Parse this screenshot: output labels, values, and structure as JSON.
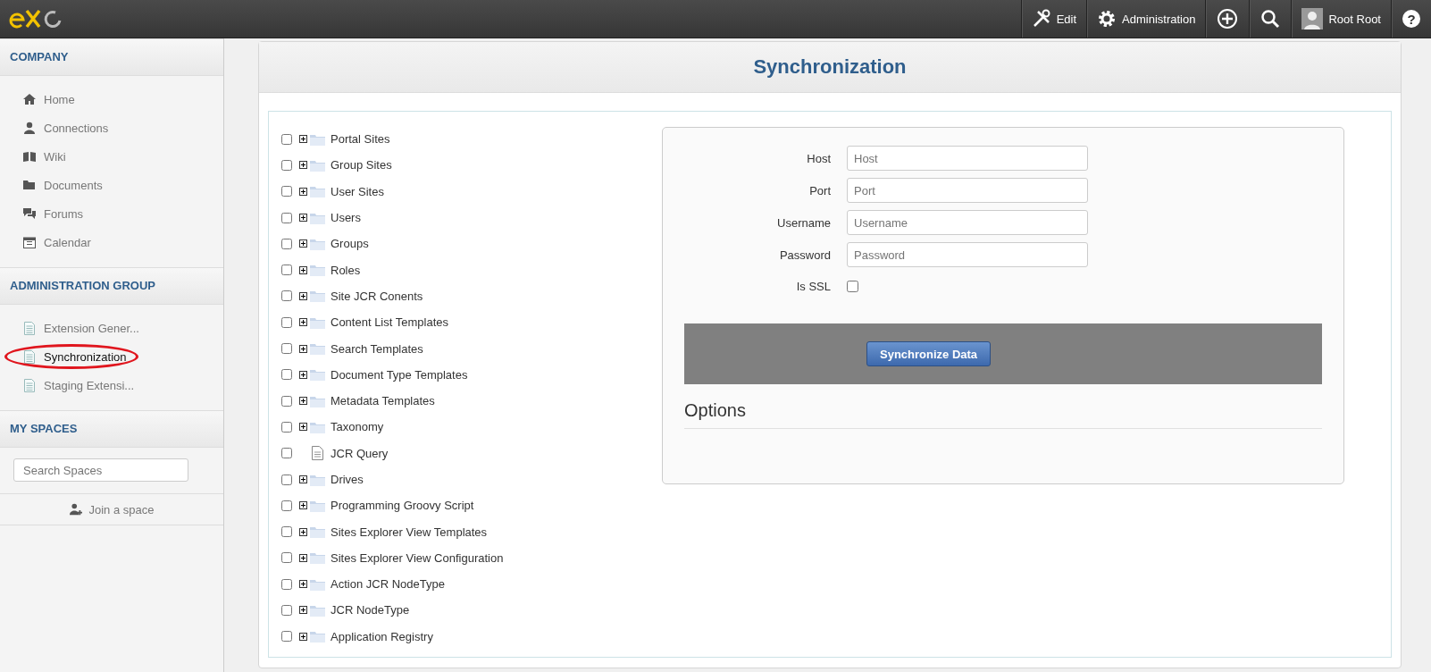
{
  "topbar": {
    "items": [
      {
        "kind": "edit",
        "label": "Edit"
      },
      {
        "kind": "admin",
        "label": "Administration"
      },
      {
        "kind": "add"
      },
      {
        "kind": "search"
      },
      {
        "kind": "user",
        "label": "Root Root"
      },
      {
        "kind": "help",
        "label": "?"
      }
    ]
  },
  "sidebar": {
    "sections": [
      {
        "title": "COMPANY",
        "items": [
          {
            "kind": "home",
            "label": "Home",
            "selected": false
          },
          {
            "kind": "user",
            "label": "Connections",
            "selected": false
          },
          {
            "kind": "book",
            "label": "Wiki",
            "selected": false
          },
          {
            "kind": "folder",
            "label": "Documents",
            "selected": false
          },
          {
            "kind": "chat",
            "label": "Forums",
            "selected": false
          },
          {
            "kind": "calendar",
            "label": "Calendar",
            "selected": false
          }
        ]
      },
      {
        "title": "ADMINISTRATION GROUP",
        "items": [
          {
            "kind": "page",
            "label": "Extension Gener...",
            "selected": false
          },
          {
            "kind": "page",
            "label": "Synchronization",
            "selected": true,
            "circled": true
          },
          {
            "kind": "page",
            "label": "Staging Extensi...",
            "selected": false
          }
        ]
      },
      {
        "title": "MY SPACES",
        "search": {
          "placeholder": "Search Spaces"
        },
        "join": "Join a space"
      }
    ]
  },
  "page": {
    "title": "Synchronization",
    "tree": [
      {
        "kind": "folder",
        "label": "Portal Sites",
        "checked": false
      },
      {
        "kind": "folder",
        "label": "Group Sites",
        "checked": false
      },
      {
        "kind": "folder",
        "label": "User Sites",
        "checked": false
      },
      {
        "kind": "folder",
        "label": "Users",
        "checked": false
      },
      {
        "kind": "folder",
        "label": "Groups",
        "checked": false
      },
      {
        "kind": "folder",
        "label": "Roles",
        "checked": false
      },
      {
        "kind": "folder",
        "label": "Site JCR Conents",
        "checked": false
      },
      {
        "kind": "folder",
        "label": "Content List Templates",
        "checked": false
      },
      {
        "kind": "folder",
        "label": "Search Templates",
        "checked": false
      },
      {
        "kind": "folder",
        "label": "Document Type Templates",
        "checked": false
      },
      {
        "kind": "folder",
        "label": "Metadata Templates",
        "checked": false
      },
      {
        "kind": "folder",
        "label": "Taxonomy",
        "checked": false
      },
      {
        "kind": "file",
        "label": "JCR Query",
        "checked": false
      },
      {
        "kind": "folder",
        "label": "Drives",
        "checked": false
      },
      {
        "kind": "folder",
        "label": "Programming Groovy Script",
        "checked": false
      },
      {
        "kind": "folder",
        "label": "Sites Explorer View Templates",
        "checked": false
      },
      {
        "kind": "folder",
        "label": "Sites Explorer View Configuration",
        "checked": false
      },
      {
        "kind": "folder",
        "label": "Action JCR NodeType",
        "checked": false
      },
      {
        "kind": "folder",
        "label": "JCR NodeType",
        "checked": false
      },
      {
        "kind": "folder",
        "label": "Application Registry",
        "checked": false
      }
    ],
    "form": {
      "fields": [
        {
          "kind": "text",
          "label": "Host",
          "placeholder": "Host"
        },
        {
          "kind": "text",
          "label": "Port",
          "placeholder": "Port"
        },
        {
          "kind": "text",
          "label": "Username",
          "placeholder": "Username"
        },
        {
          "kind": "password",
          "label": "Password",
          "placeholder": "Password"
        },
        {
          "kind": "checkbox",
          "label": "Is SSL",
          "checked": false
        }
      ],
      "button": "Synchronize Data",
      "options_title": "Options"
    }
  }
}
